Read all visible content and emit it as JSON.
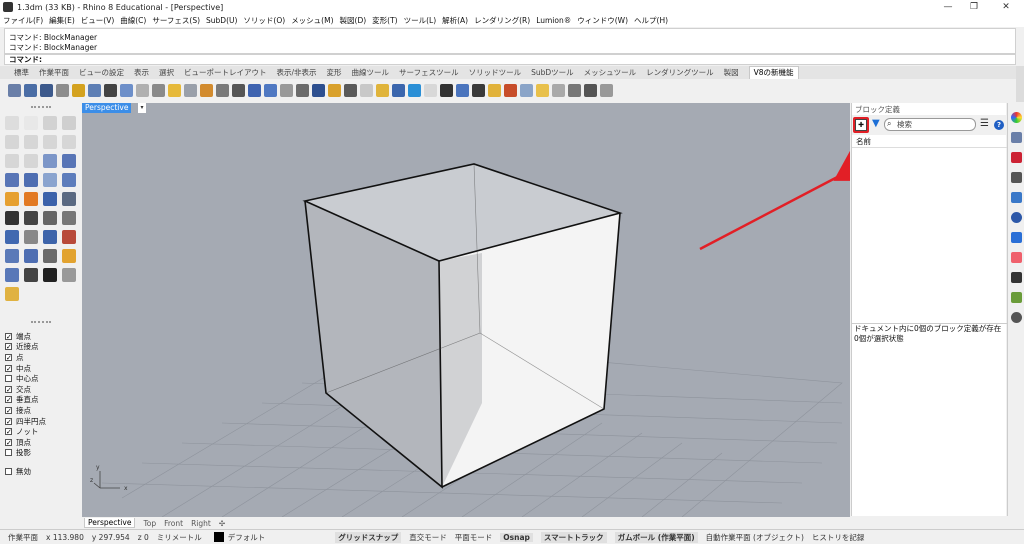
{
  "window": {
    "title": "1.3dm (33 KB) - Rhino 8 Educational - [Perspective]"
  },
  "menu": [
    "ファイル(F)",
    "編集(E)",
    "ビュー(V)",
    "曲線(C)",
    "サーフェス(S)",
    "SubD(U)",
    "ソリッド(O)",
    "メッシュ(M)",
    "製図(D)",
    "変形(T)",
    "ツール(L)",
    "解析(A)",
    "レンダリング(R)",
    "Lumion®",
    "ウィンドウ(W)",
    "ヘルプ(H)"
  ],
  "command": {
    "history": [
      "コマンド: BlockManager",
      "コマンド: BlockManager"
    ],
    "prompt": "コマンド:"
  },
  "tabs": [
    "標準",
    "作業平面",
    "ビューの設定",
    "表示",
    "選択",
    "ビューポートレイアウト",
    "表示/非表示",
    "変形",
    "曲線ツール",
    "サーフェスツール",
    "ソリッドツール",
    "SubDツール",
    "メッシュツール",
    "レンダリングツール",
    "製図",
    "V8の新機能"
  ],
  "active_tab": "V8の新機能",
  "snaps": [
    {
      "label": "端点",
      "checked": true
    },
    {
      "label": "近接点",
      "checked": true
    },
    {
      "label": "点",
      "checked": true
    },
    {
      "label": "中点",
      "checked": true
    },
    {
      "label": "中心点",
      "checked": false
    },
    {
      "label": "交点",
      "checked": true
    },
    {
      "label": "垂直点",
      "checked": true
    },
    {
      "label": "接点",
      "checked": true
    },
    {
      "label": "四半円点",
      "checked": true
    },
    {
      "label": "ノット",
      "checked": true
    },
    {
      "label": "頂点",
      "checked": true
    },
    {
      "label": "投影",
      "checked": false
    },
    {
      "label": "無効",
      "checked": false
    }
  ],
  "viewport": {
    "name": "Perspective",
    "caret": "▾",
    "axis": {
      "x": "x",
      "y": "y",
      "z": "z"
    }
  },
  "viewport_tabs": [
    "Perspective",
    "Top",
    "Front",
    "Right",
    "✣"
  ],
  "block_panel": {
    "title": "ブロック定義",
    "search_placeholder": "検索",
    "column": "名前",
    "footer": [
      "ドキュメント内に0個のブロック定義が存在",
      "0個が選択状態"
    ]
  },
  "status": {
    "x": "x 113.980",
    "y": "y 297.954",
    "z": "z 0",
    "units": "ミリメートル",
    "layer": "デフォルト",
    "items": [
      "グリッドスナップ",
      "直交モード",
      "平面モード",
      "Osnap",
      "スマートトラック",
      "ガムボール (作業平面)",
      "自動作業平面 (オブジェクト)",
      "ヒストリを記録"
    ],
    "cplane": "作業平面"
  },
  "colors": {
    "accent": "#3c8ee8",
    "highlight": "#e21f26",
    "viewport_bg": "#a5aab3"
  }
}
